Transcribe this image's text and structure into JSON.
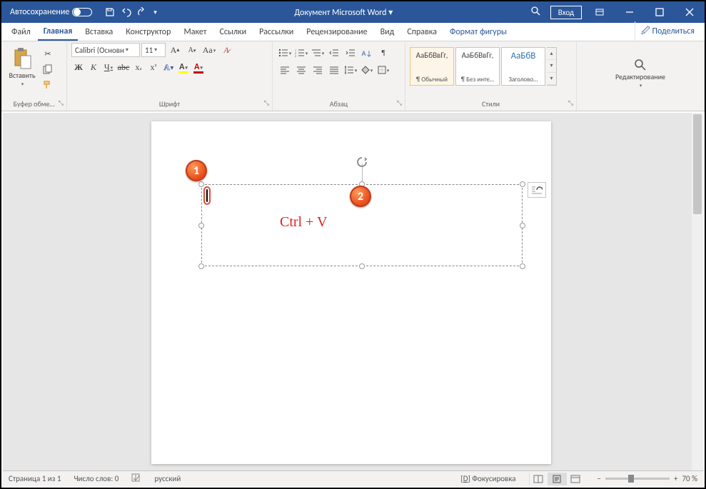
{
  "titlebar": {
    "autosave": "Автосохранение",
    "doc_title": "Документ Microsoft Word ▾",
    "login": "Вход"
  },
  "tabs": {
    "file": "Файл",
    "home": "Главная",
    "insert": "Вставка",
    "design": "Конструктор",
    "layout": "Макет",
    "references": "Ссылки",
    "mailings": "Рассылки",
    "review": "Рецензирование",
    "view": "Вид",
    "help": "Справка",
    "shape_format": "Формат фигуры",
    "share": "Поделиться"
  },
  "clipboard": {
    "paste": "Вставить",
    "group": "Буфер обме…"
  },
  "font": {
    "name": "Calibri (Основн",
    "size": "11",
    "group": "Шрифт"
  },
  "paragraph": {
    "group": "Абзац"
  },
  "styles": {
    "preview": "АаБбВвГг,",
    "preview_heading": "АаБбВ",
    "normal": "¶ Обычный",
    "no_spacing": "¶ Без инте…",
    "heading1": "Заголово…",
    "group": "Стили"
  },
  "editing": {
    "label": "Редактирование"
  },
  "canvas": {
    "annotation": "Ctrl + V",
    "marker1": "1",
    "marker2": "2"
  },
  "status": {
    "page": "Страница 1 из 1",
    "words": "Число слов: 0",
    "lang": "русский",
    "focus": "Фокусировка",
    "zoom": "70 %"
  }
}
